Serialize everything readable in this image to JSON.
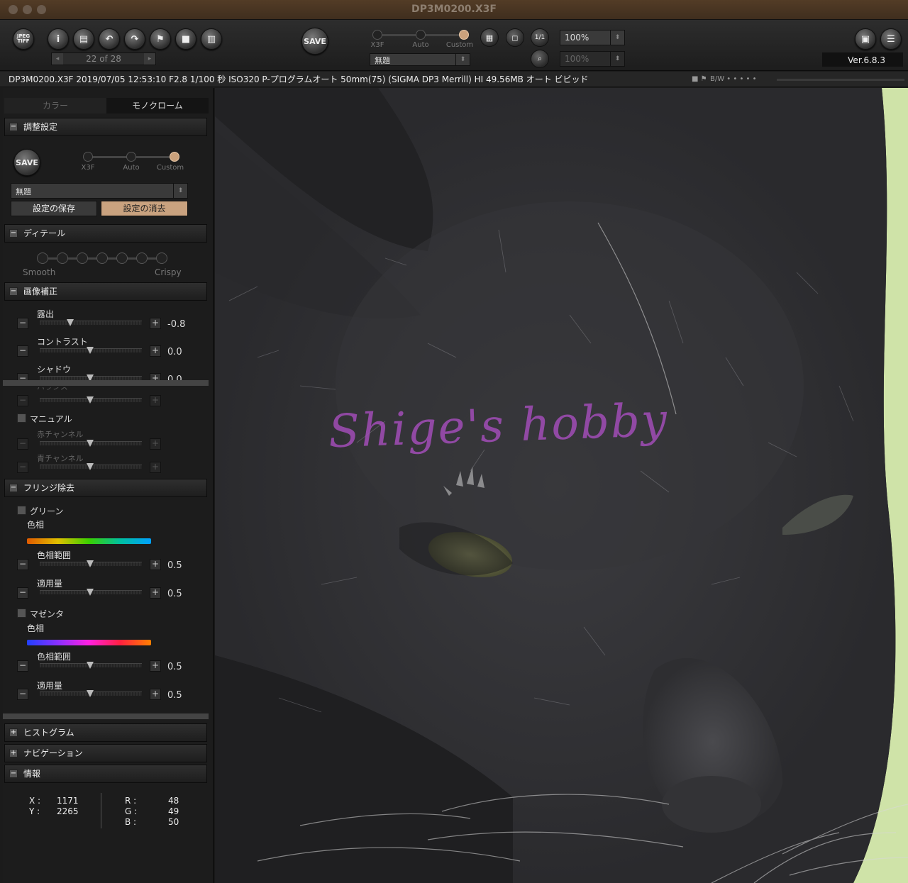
{
  "window": {
    "title": "DP3M0200.X3F"
  },
  "toolbar": {
    "buttons": [
      "jpeg-tiff",
      "info",
      "stamp",
      "rotate-left",
      "rotate-right",
      "flag",
      "lock",
      "trash"
    ],
    "jpeg_label": "JPEG TIFF",
    "pager": {
      "text": "22 of 28",
      "prev": "◂",
      "next": "▸"
    },
    "save_label": "SAVE",
    "mode_slider": {
      "options": [
        "X3F",
        "Auto",
        "Custom"
      ],
      "selected": "Custom"
    },
    "preset_select": "無題",
    "zoom_primary": "100%",
    "zoom_secondary": "100%",
    "one_to_one": "1/1",
    "version": "Ver.6.8.3"
  },
  "infobar": {
    "text": "DP3M0200.X3F 2019/07/05 12:53:10 F2.8 1/100 秒 ISO320 P-プログラムオート 50mm(75) (SIGMA DP3 Merrill) HI 49.56MB オート ビビッド",
    "bw_label": "B/W • • • • •"
  },
  "sidebar": {
    "tabs": [
      {
        "label": "カラー",
        "active": false
      },
      {
        "label": "モノクローム",
        "active": true
      }
    ],
    "adjust": {
      "header": "調整設定",
      "save_label": "SAVE",
      "slider": {
        "options": [
          "X3F",
          "Auto",
          "Custom"
        ],
        "selected": "Custom"
      },
      "preset": "無題",
      "save_settings": "設定の保存",
      "delete_settings": "設定の消去"
    },
    "detail": {
      "header": "ディテール",
      "left": "Smooth",
      "right": "Crispy",
      "dots": 7,
      "selected_index": 0
    },
    "image_correction": {
      "header": "画像補正",
      "sliders": [
        {
          "label": "露出",
          "value": "-0.8"
        },
        {
          "label": "コントラスト",
          "value": "0.0"
        },
        {
          "label": "シャドウ",
          "value": "0.0"
        }
      ],
      "partial_label": "バランス",
      "manual_label": "マニュアル",
      "red_label": "赤チャンネル",
      "blue_label": "青チャンネル"
    },
    "fringe": {
      "header": "フリンジ除去",
      "green": {
        "label": "グリーン",
        "hue_label": "色相",
        "range_label": "色相範囲",
        "range_value": "0.5",
        "amount_label": "適用量",
        "amount_value": "0.5"
      },
      "magenta": {
        "label": "マゼンタ",
        "hue_label": "色相",
        "range_label": "色相範囲",
        "range_value": "0.5",
        "amount_label": "適用量",
        "amount_value": "0.5"
      }
    },
    "histogram": {
      "header": "ヒストグラム"
    },
    "navigation": {
      "header": "ナビゲーション"
    },
    "info": {
      "header": "情報",
      "x_label": "X :",
      "x": "1171",
      "y_label": "Y :",
      "y": "2265",
      "r_label": "R :",
      "r": "48",
      "g_label": "G :",
      "g": "49",
      "b_label": "B :",
      "b": "50"
    }
  },
  "viewer": {
    "watermark": "Shige's hobby"
  },
  "colors": {
    "accent": "#c9a27f",
    "title_bar": "#4a3624",
    "watermark": "#b050c8"
  }
}
